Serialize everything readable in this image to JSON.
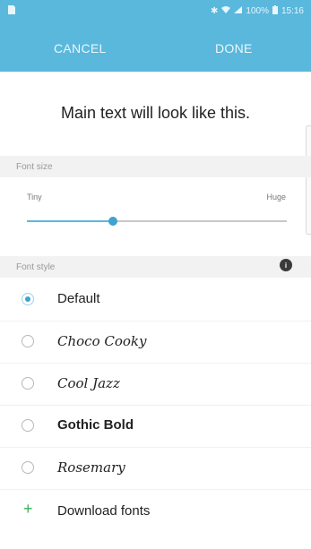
{
  "status_bar": {
    "sim_icon": "sim-card-icon",
    "bluetooth_icon": "bluetooth-icon",
    "wifi_icon": "wifi-icon",
    "signal_icon": "signal-icon",
    "battery_percent": "100%",
    "battery_icon": "battery-icon",
    "time": "15:16"
  },
  "toolbar": {
    "cancel_label": "CANCEL",
    "done_label": "DONE"
  },
  "preview_text": "Main text will look like this.",
  "font_size": {
    "header": "Font size",
    "min_label": "Tiny",
    "max_label": "Huge",
    "level_fraction": 0.33
  },
  "font_style": {
    "header": "Font style",
    "info_icon": "info-icon",
    "options": [
      {
        "label": "Default",
        "selected": true
      },
      {
        "label": "Choco Cooky",
        "selected": false
      },
      {
        "label": "Cool Jazz",
        "selected": false
      },
      {
        "label": "Gothic Bold",
        "selected": false
      },
      {
        "label": "Rosemary",
        "selected": false
      }
    ],
    "download_label": "Download fonts",
    "download_icon": "plus-icon"
  },
  "colors": {
    "accent": "#5ab8dc",
    "accent_dark": "#3fa2d0",
    "download_plus": "#3faf5a"
  }
}
